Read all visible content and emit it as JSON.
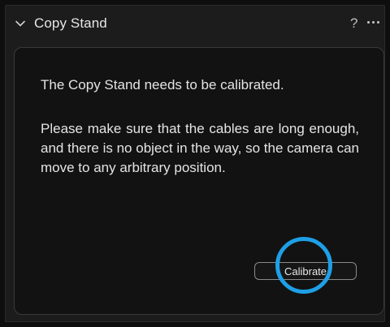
{
  "panel": {
    "title": "Copy Stand",
    "help_label": "?",
    "collapse_icon": "chevron-down-icon",
    "more_icon": "more-horizontal-icon"
  },
  "card": {
    "message_1": "The Copy Stand needs to be calibrated.",
    "message_2": "Please make sure that the cables are long enough, and there is no object in the way, so the camera can move to any arbitrary position.",
    "calibrate_label": "Calibrate"
  },
  "colors": {
    "highlight_ring": "#1e9fe6",
    "panel_bg": "#1c1c1c",
    "card_bg": "#121212"
  }
}
